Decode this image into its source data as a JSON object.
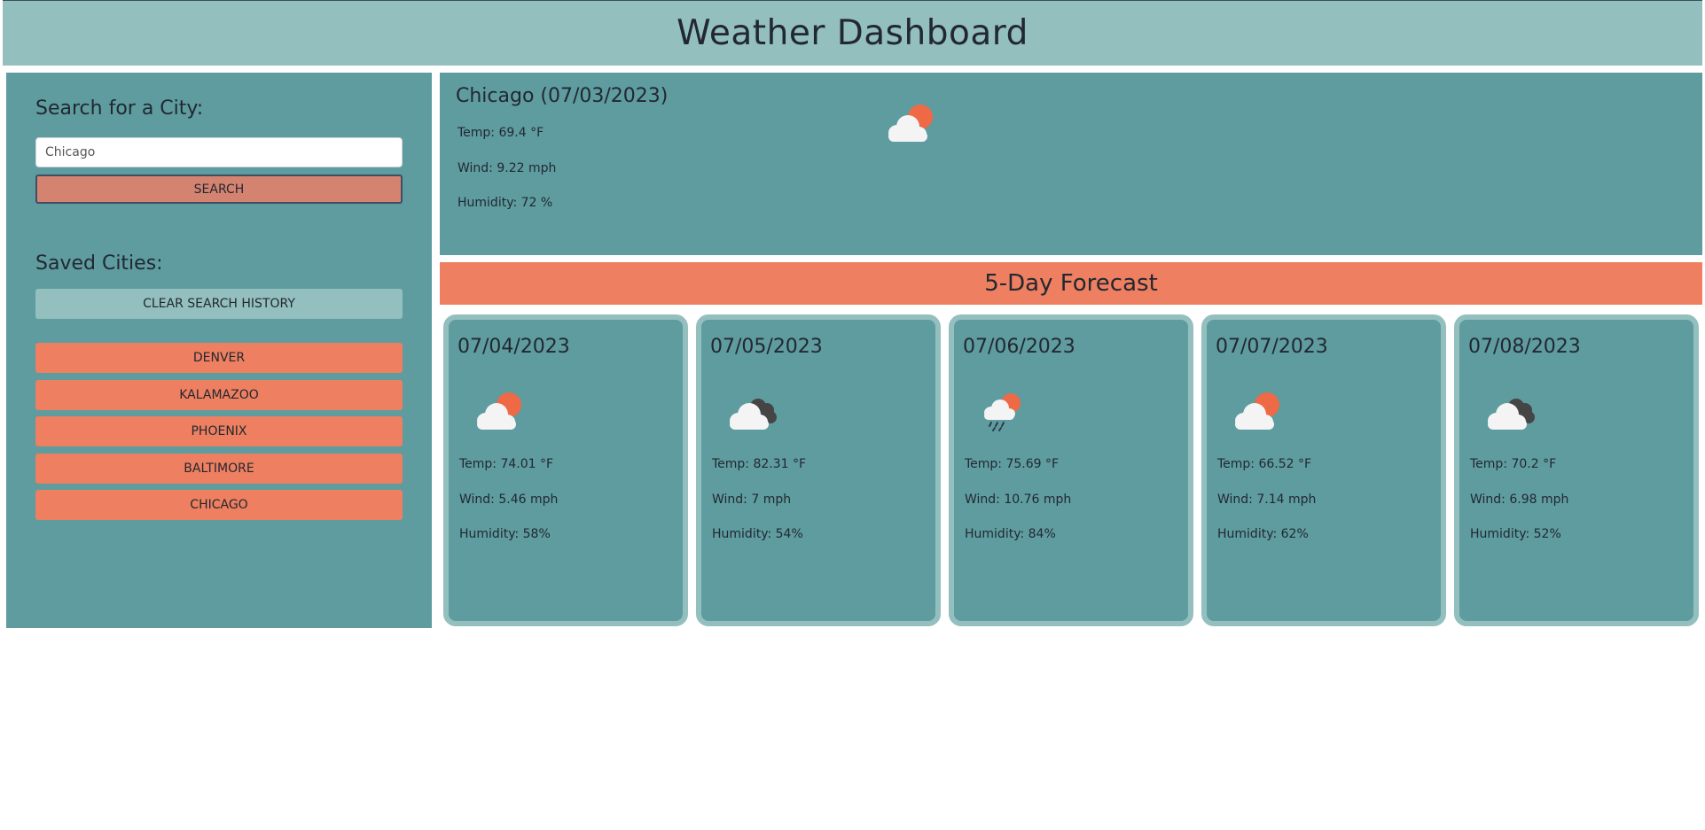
{
  "header": {
    "title": "Weather Dashboard"
  },
  "sidebar": {
    "search_heading": "Search for a City:",
    "search_value": "Chicago",
    "search_button": "SEARCH",
    "saved_heading": "Saved Cities:",
    "clear_button": "CLEAR SEARCH HISTORY",
    "cities": [
      "DENVER",
      "KALAMAZOO",
      "PHOENIX",
      "BALTIMORE",
      "CHICAGO"
    ]
  },
  "current": {
    "title": "Chicago (07/03/2023)",
    "icon": "partly-cloudy-icon",
    "temp": "Temp: 69.4 °F",
    "wind": "Wind: 9.22 mph",
    "humidity": "Humidity: 72 %"
  },
  "forecast": {
    "title": "5-Day Forecast",
    "days": [
      {
        "date": "07/04/2023",
        "icon": "partly-cloudy-icon",
        "temp": "Temp: 74.01 °F",
        "wind": "Wind: 5.46 mph",
        "humidity": "Humidity: 58%"
      },
      {
        "date": "07/05/2023",
        "icon": "broken-clouds-icon",
        "temp": "Temp: 82.31 °F",
        "wind": "Wind: 7 mph",
        "humidity": "Humidity: 54%"
      },
      {
        "date": "07/06/2023",
        "icon": "rain-icon",
        "temp": "Temp: 75.69 °F",
        "wind": "Wind: 10.76 mph",
        "humidity": "Humidity: 84%"
      },
      {
        "date": "07/07/2023",
        "icon": "partly-cloudy-icon",
        "temp": "Temp: 66.52 °F",
        "wind": "Wind: 7.14 mph",
        "humidity": "Humidity: 62%"
      },
      {
        "date": "07/08/2023",
        "icon": "broken-clouds-icon",
        "temp": "Temp: 70.2 °F",
        "wind": "Wind: 6.98 mph",
        "humidity": "Humidity: 52%"
      }
    ]
  },
  "colors": {
    "header_bg": "#94bfbf",
    "panel_bg": "#5e9c9f",
    "accent": "#ee7f60",
    "search_button_bg": "#d58371",
    "sun": "#ee6a46",
    "dark_cloud": "#454545",
    "cloud": "#f4f4f4"
  }
}
